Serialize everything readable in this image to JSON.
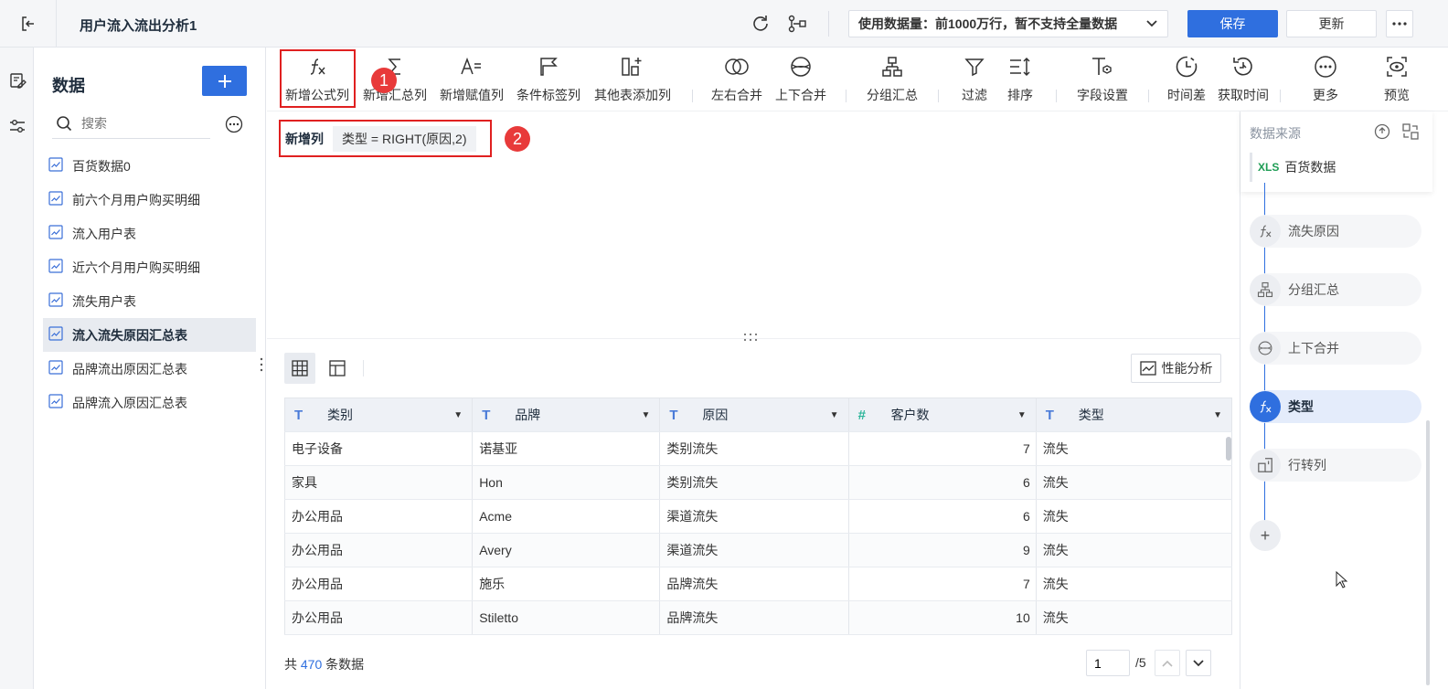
{
  "header": {
    "title": "用户流入流出分析1",
    "data_limit": "使用数据量：前1000万行，暂不支持全量数据",
    "save_label": "保存",
    "update_label": "更新"
  },
  "data_panel": {
    "title": "数据",
    "search_placeholder": "搜索",
    "tables": [
      {
        "label": "百货数据0"
      },
      {
        "label": "前六个月用户购买明细"
      },
      {
        "label": "流入用户表"
      },
      {
        "label": "近六个月用户购买明细"
      },
      {
        "label": "流失用户表"
      },
      {
        "label": "流入流失原因汇总表",
        "active": true
      },
      {
        "label": "品牌流出原因汇总表"
      },
      {
        "label": "品牌流入原因汇总表"
      }
    ]
  },
  "toolbar": {
    "items": [
      {
        "label": "新增公式列",
        "icon": "formula-icon"
      },
      {
        "label": "新增汇总列",
        "icon": "sum-icon"
      },
      {
        "label": "新增赋值列",
        "icon": "assign-icon"
      },
      {
        "label": "条件标签列",
        "icon": "flag-icon"
      },
      {
        "label": "其他表添加列",
        "icon": "add-column-icon"
      },
      {
        "label": "左右合并",
        "icon": "merge-horizontal-icon"
      },
      {
        "label": "上下合并",
        "icon": "merge-vertical-icon"
      },
      {
        "label": "分组汇总",
        "icon": "group-icon"
      },
      {
        "label": "过滤",
        "icon": "filter-icon"
      },
      {
        "label": "排序",
        "icon": "sort-icon"
      },
      {
        "label": "字段设置",
        "icon": "field-settings-icon"
      },
      {
        "label": "时间差",
        "icon": "clock-icon"
      },
      {
        "label": "获取时间",
        "icon": "history-icon"
      },
      {
        "label": "更多",
        "icon": "more-icon"
      },
      {
        "label": "预览",
        "icon": "preview-icon"
      }
    ]
  },
  "annotations": {
    "badge1": "1",
    "badge2": "2"
  },
  "formula": {
    "label": "新增列",
    "expression": "类型 = RIGHT(原因,2)"
  },
  "grid": {
    "perf_label": "性能分析",
    "columns": [
      {
        "name": "类别",
        "type": "text"
      },
      {
        "name": "品牌",
        "type": "text"
      },
      {
        "name": "原因",
        "type": "text"
      },
      {
        "name": "客户数",
        "type": "number"
      },
      {
        "name": "类型",
        "type": "text"
      }
    ],
    "rows": [
      [
        "电子设备",
        "诺基亚",
        "类别流失",
        "7",
        "流失"
      ],
      [
        "家具",
        "Hon",
        "类别流失",
        "6",
        "流失"
      ],
      [
        "办公用品",
        "Acme",
        "渠道流失",
        "6",
        "流失"
      ],
      [
        "办公用品",
        "Avery",
        "渠道流失",
        "9",
        "流失"
      ],
      [
        "办公用品",
        "施乐",
        "品牌流失",
        "7",
        "流失"
      ],
      [
        "办公用品",
        "Stiletto",
        "品牌流失",
        "10",
        "流失"
      ]
    ]
  },
  "footer": {
    "total_prefix": "共",
    "total_count": "470",
    "total_suffix": "条数据",
    "page_value": "1",
    "page_total": "/5"
  },
  "steps_panel": {
    "source_title": "数据来源",
    "source_item": "百货数据",
    "source_badge": "XLS",
    "steps": [
      {
        "label": "流失原因",
        "icon": "formula-icon"
      },
      {
        "label": "分组汇总",
        "icon": "group-icon"
      },
      {
        "label": "上下合并",
        "icon": "merge-vertical-icon"
      },
      {
        "label": "类型",
        "icon": "formula-icon",
        "active": true
      },
      {
        "label": "行转列",
        "icon": "pivot-icon"
      }
    ],
    "add_label": "+"
  },
  "colors": {
    "primary": "#2f6fdf",
    "highlight": "#e02020",
    "badge": "#e83a3a"
  }
}
